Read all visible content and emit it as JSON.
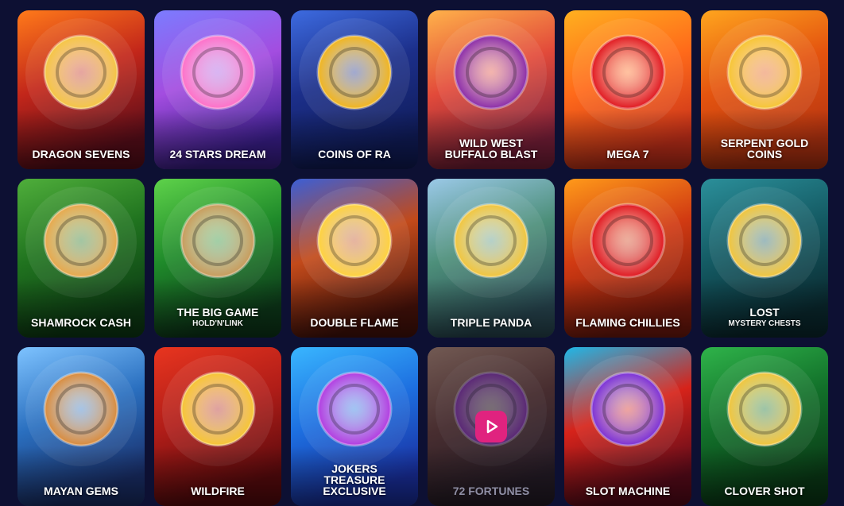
{
  "games": [
    {
      "title": "DRAGON SEVENS",
      "icon": "dragon-mask-icon",
      "bg": [
        "#ff7a1a",
        "#c2261a",
        "#5a0d1a"
      ],
      "accent": "#f5c542"
    },
    {
      "title": "24 STARS DREAM",
      "icon": "anime-girl-icon",
      "bg": [
        "#7b7cff",
        "#a34de0",
        "#3b1f8f"
      ],
      "accent": "#ff6ec7"
    },
    {
      "title": "COINS OF RA",
      "icon": "pharaoh-coin-icon",
      "bg": [
        "#3d6be0",
        "#1c2f8a",
        "#101c5a"
      ],
      "accent": "#f2b51c"
    },
    {
      "title": "WILD WEST\nBUFFALO BLAST",
      "icon": "buffalo-icon",
      "bg": [
        "#ffb24a",
        "#e24a3a",
        "#7b1f3a"
      ],
      "accent": "#8a2ba8"
    },
    {
      "title": "MEGA 7",
      "icon": "seven-cherry-icon",
      "bg": [
        "#ffb01f",
        "#ff6a1a",
        "#c7301a"
      ],
      "accent": "#e0161e"
    },
    {
      "title": "SERPENT GOLD\nCOINS",
      "icon": "serpent-icon",
      "bg": [
        "#ffa51e",
        "#e4540f",
        "#b53311"
      ],
      "accent": "#f7c532"
    },
    {
      "title": "SHAMROCK CASH",
      "icon": "leprechaun-icon",
      "bg": [
        "#4fae3b",
        "#20731f",
        "#0d3d14"
      ],
      "accent": "#e8a84a"
    },
    {
      "title": "THE BIG GAME",
      "subtitle": "HOLD'N'LINK",
      "icon": "gentleman-icon",
      "bg": [
        "#5ed24a",
        "#1f8a2a",
        "#0d3a1a"
      ],
      "accent": "#c89b5a"
    },
    {
      "title": "DOUBLE FLAME",
      "icon": "slot-777-icon",
      "bg": [
        "#3b5fd6",
        "#c24a1a",
        "#4a120a"
      ],
      "accent": "#ffd23b"
    },
    {
      "title": "TRIPLE PANDA",
      "icon": "panda-icon",
      "bg": [
        "#9bc9e8",
        "#4d8f7a",
        "#2a4a55"
      ],
      "accent": "#f2c53a"
    },
    {
      "title": "FLAMING CHILLIES",
      "icon": "chili-icon",
      "bg": [
        "#ff9a1a",
        "#d13a12",
        "#7a1a0d"
      ],
      "accent": "#e0161e"
    },
    {
      "title": "LOST",
      "subtitle": "MYSTERY CHESTS",
      "icon": "treasure-chest-icon",
      "bg": [
        "#2b8f9a",
        "#145a63",
        "#0a2a30"
      ],
      "accent": "#f2c53a"
    },
    {
      "title": "MAYAN GEMS",
      "icon": "mayan-warrior-icon",
      "bg": [
        "#7ec3ff",
        "#2a6fbf",
        "#1a2f6a"
      ],
      "accent": "#d98a3a"
    },
    {
      "title": "WILDFIRE",
      "icon": "jester-icon",
      "bg": [
        "#e8351f",
        "#b01d18",
        "#5a0a0d"
      ],
      "accent": "#f7c532"
    },
    {
      "title": "JOKERS\nTREASURE\nEXCLUSIVE",
      "icon": "gems-cards-icon",
      "bg": [
        "#39b6ff",
        "#1d6fe0",
        "#1a2fa0"
      ],
      "accent": "#b23ae0"
    },
    {
      "title": "72 FORTUNES",
      "icon": "red-panda-icon",
      "bg": [
        "#b68a6a",
        "#6a3a2a",
        "#2a1a1a"
      ],
      "accent": "#8a2ba8",
      "dim": true,
      "play": true
    },
    {
      "title": "SLOT MACHINE",
      "icon": "slot-machine-icon",
      "bg": [
        "#1fb8e8",
        "#d6231a",
        "#5a0a1a"
      ],
      "accent": "#7b2fd6"
    },
    {
      "title": "CLOVER SHOT",
      "icon": "leprechaun-lantern-icon",
      "bg": [
        "#2fb34a",
        "#12702a",
        "#0a3a16"
      ],
      "accent": "#f2c53a"
    }
  ]
}
